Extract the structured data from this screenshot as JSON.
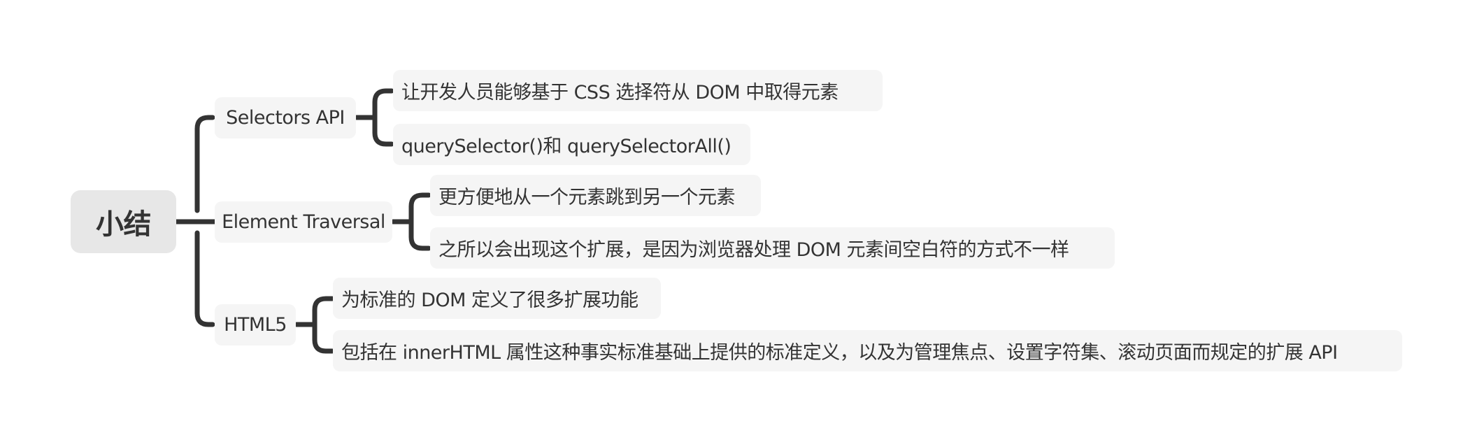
{
  "mindmap": {
    "root": {
      "label": "小结"
    },
    "branches": [
      {
        "label": "Selectors API",
        "children": [
          {
            "label": "让开发人员能够基于 CSS 选择符从 DOM 中取得元素"
          },
          {
            "label": "querySelector()和 querySelectorAll()"
          }
        ]
      },
      {
        "label": "Element Traversal",
        "children": [
          {
            "label": "更方便地从一个元素跳到另一个元素"
          },
          {
            "label": "之所以会出现这个扩展，是因为浏览器处理 DOM 元素间空白符的方式不一样"
          }
        ]
      },
      {
        "label": "HTML5",
        "children": [
          {
            "label": "为标准的 DOM 定义了很多扩展功能"
          },
          {
            "label": "包括在 innerHTML 属性这种事实标准基础上提供的标准定义，以及为管理焦点、设置字符集、滚动页面而规定的扩展 API"
          }
        ]
      }
    ],
    "colors": {
      "connector": "#333333",
      "root_fill": "#e7e7e7",
      "node_fill": "#f5f5f5",
      "text": "#333333",
      "background": "#ffffff"
    }
  }
}
